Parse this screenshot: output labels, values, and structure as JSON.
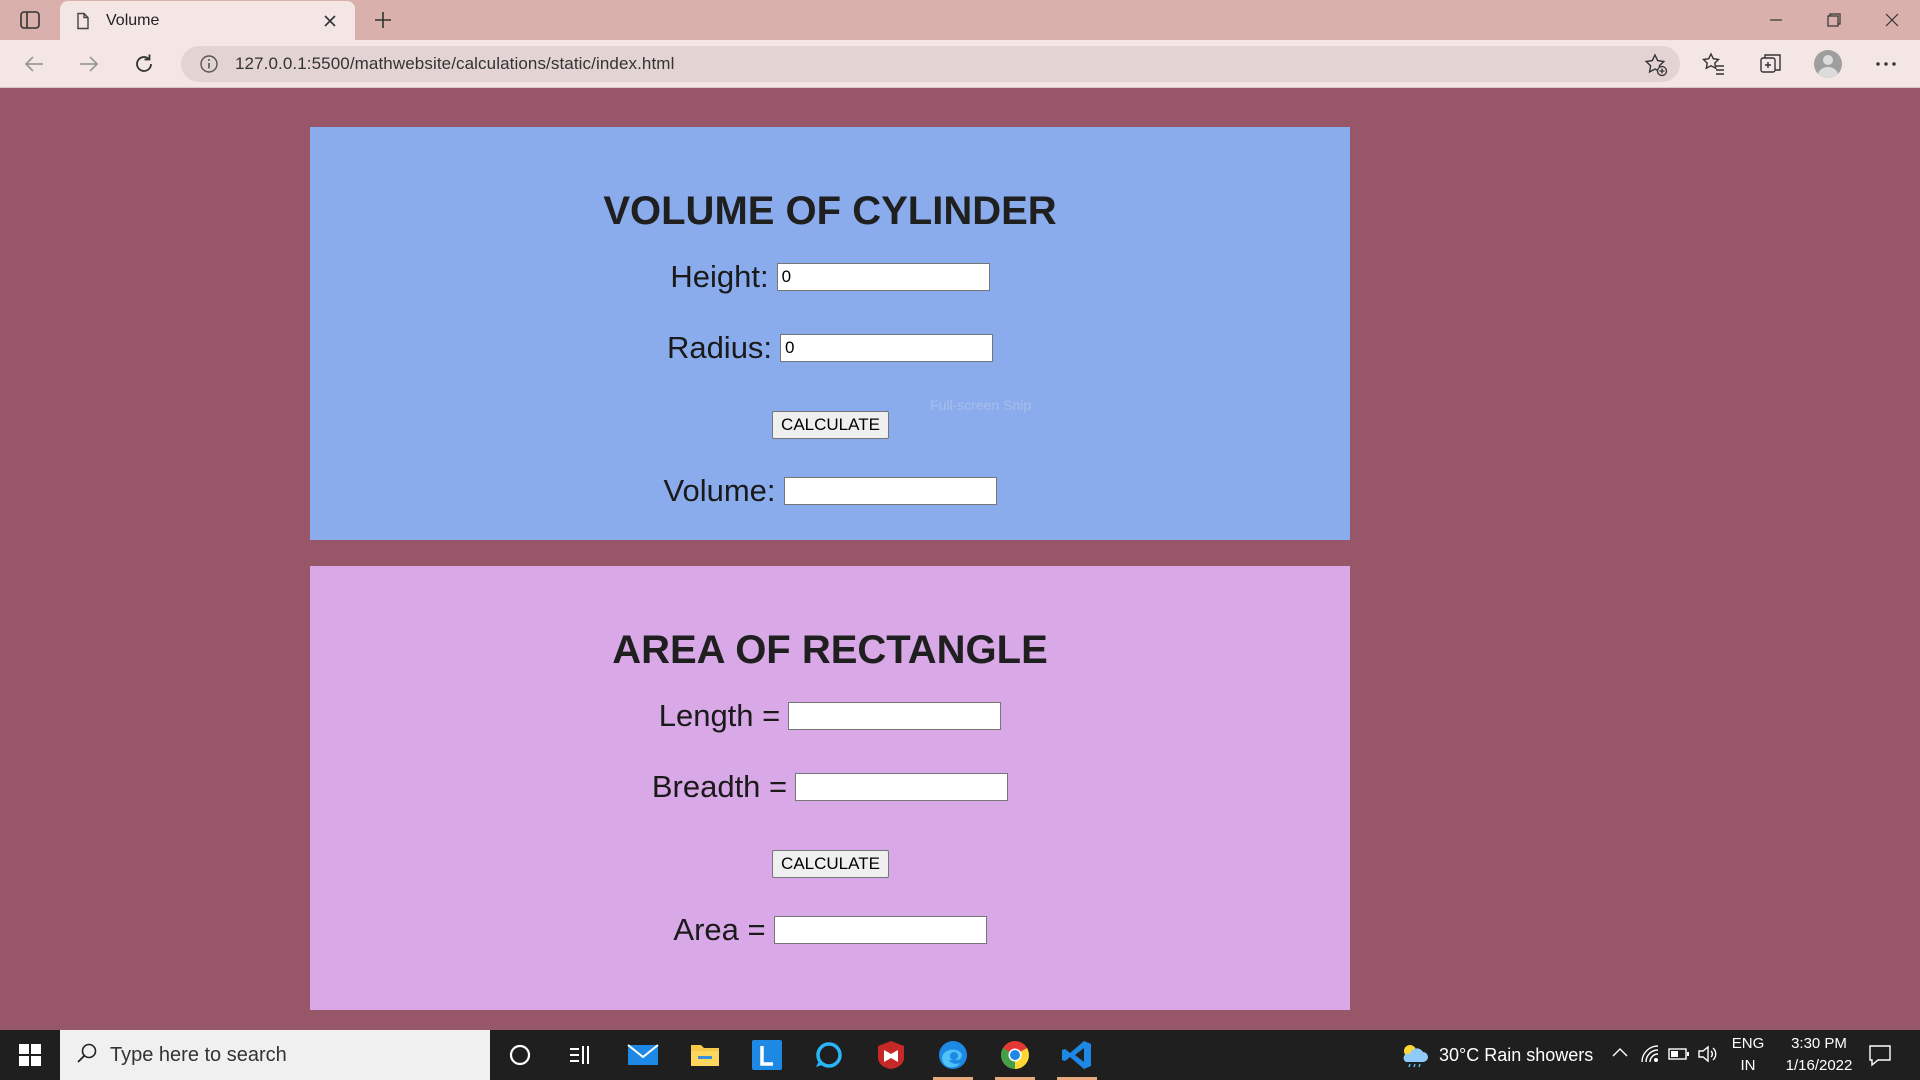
{
  "browser": {
    "tab_title": "Volume",
    "url": "127.0.0.1:5500/mathwebsite/calculations/static/index.html"
  },
  "cylinder": {
    "title": "VOLUME OF CYLINDER",
    "height_label": "Height:",
    "height_value": "0",
    "radius_label": "Radius:",
    "radius_value": "0",
    "button_label": "CALCULATE",
    "volume_label": "Volume:",
    "volume_value": "",
    "snip_overlay": "Full-screen Snip"
  },
  "rectangle": {
    "title": "AREA OF RECTANGLE",
    "length_label": "Length =",
    "length_value": "",
    "breadth_label": "Breadth =",
    "breadth_value": "",
    "button_label": "CALCULATE",
    "area_label": "Area =",
    "area_value": ""
  },
  "taskbar": {
    "search_placeholder": "Type here to search",
    "weather": "30°C  Rain showers",
    "lang_top": "ENG",
    "lang_bottom": "IN",
    "time": "3:30 PM",
    "date": "1/16/2022"
  },
  "colors": {
    "page_bg": "#985669",
    "cylinder_panel": "#8aaced",
    "rectangle_panel": "#d8a8e7"
  }
}
